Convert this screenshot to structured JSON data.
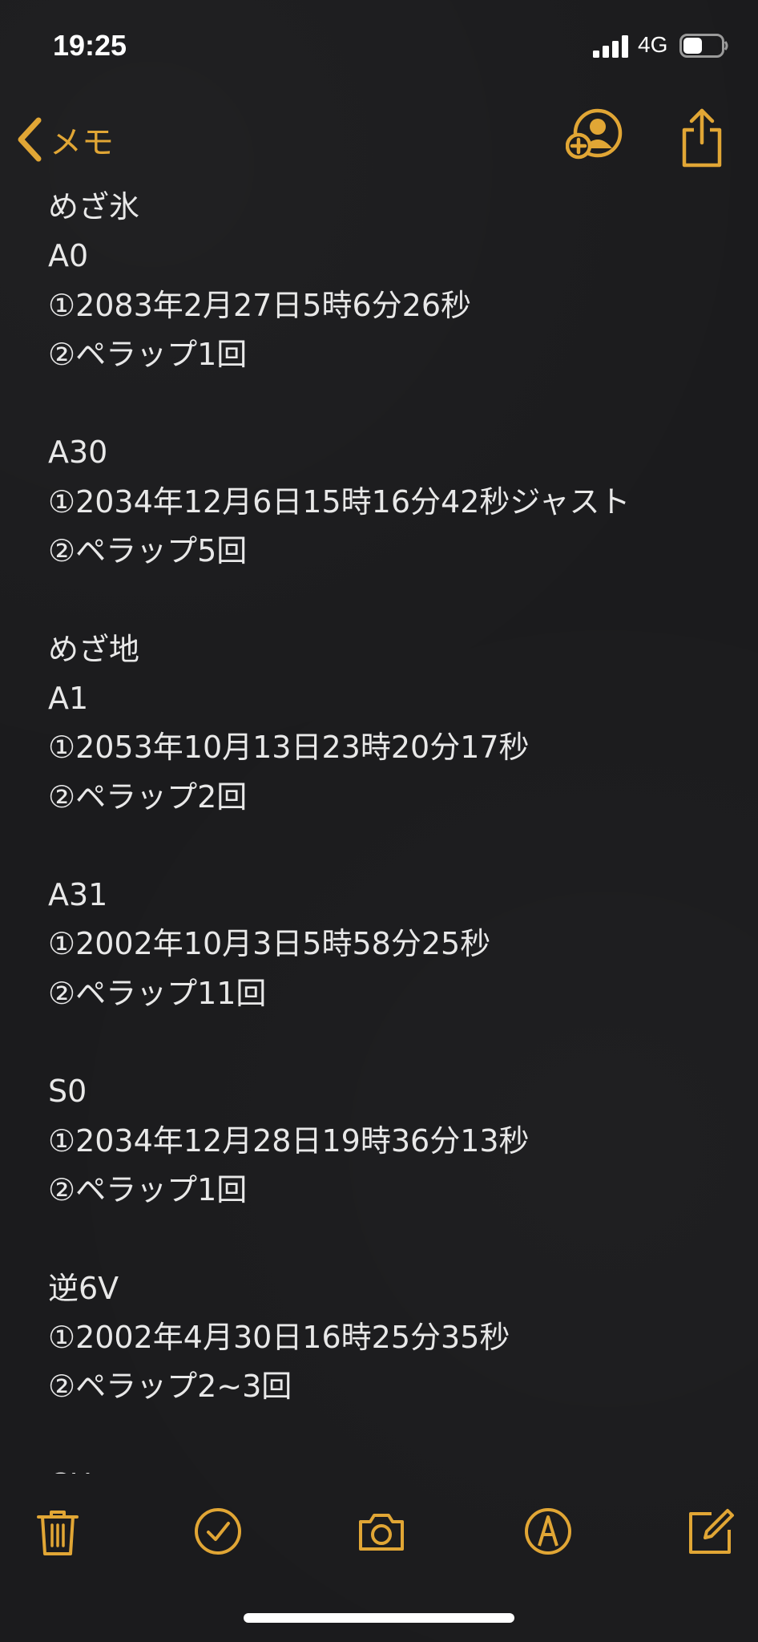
{
  "status_bar": {
    "time": "19:25",
    "network": "4G",
    "signal_icon": "cellular-signal-icon",
    "battery_icon": "battery-icon",
    "battery_level": 0.5
  },
  "nav": {
    "back_label": "メモ",
    "back_icon": "chevron-left-icon",
    "add_person_icon": "add-person-icon",
    "share_icon": "share-icon"
  },
  "accent_color": "#e1a635",
  "note": {
    "lines": [
      "めざ氷",
      "A0",
      "①2083年2月27日5時6分26秒",
      "②ペラップ1回",
      "",
      "A30",
      "①2034年12月6日15時16分42秒ジャスト",
      "②ペラップ5回",
      "",
      "めざ地",
      "A1",
      "①2053年10月13日23時20分17秒",
      "②ペラップ2回",
      "",
      "A31",
      "①2002年10月3日5時58分25秒",
      "②ペラップ11回",
      "",
      "S0",
      "①2034年12月28日19時36分13秒",
      "②ペラップ1回",
      "",
      "逆6V",
      "①2002年4月30日16時25分35秒",
      "②ペラップ2~3回",
      "",
      "CH"
    ]
  },
  "toolbar": {
    "items": [
      "trash-icon",
      "checklist-icon",
      "camera-icon",
      "markup-icon",
      "compose-icon"
    ]
  }
}
